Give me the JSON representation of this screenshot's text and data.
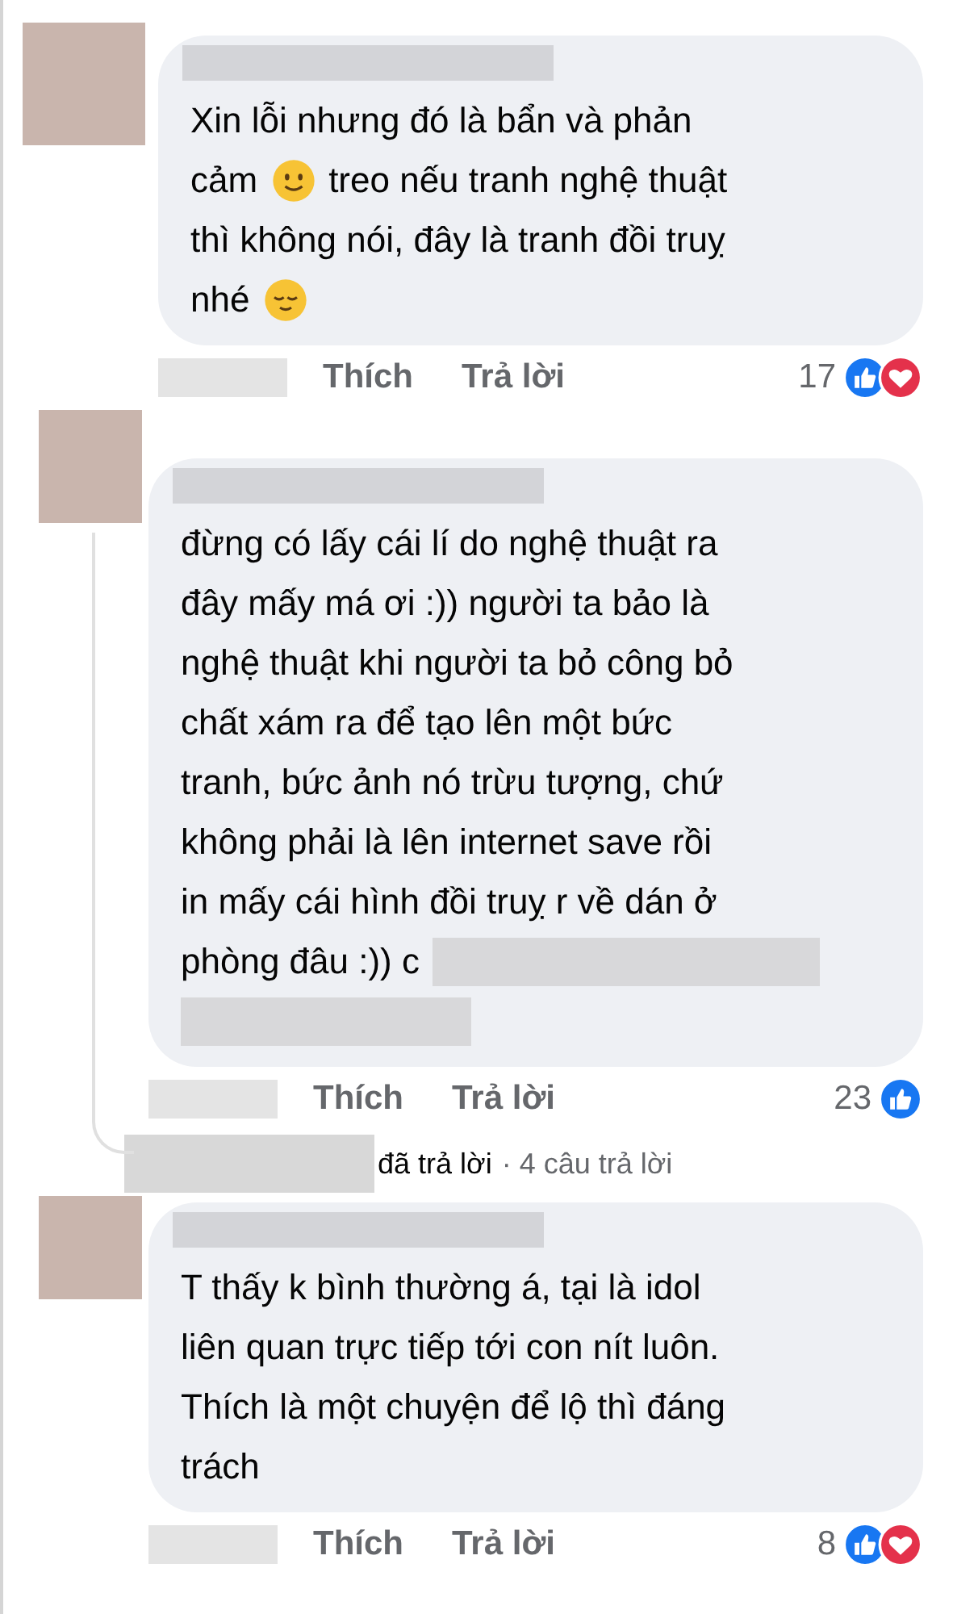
{
  "comments": [
    {
      "lines": [
        [
          {
            "kind": "text",
            "text": "Xin lỗi nhưng đó là bẩn và phản"
          }
        ],
        [
          {
            "kind": "text",
            "text": "cảm"
          },
          {
            "kind": "smile"
          },
          {
            "kind": "text",
            "text": "treo nếu tranh nghệ thuật"
          }
        ],
        [
          {
            "kind": "text",
            "text": "thì không nói, đây là tranh đồi truỵ"
          }
        ],
        [
          {
            "kind": "text",
            "text": "nhé"
          },
          {
            "kind": "relieved"
          }
        ]
      ],
      "actions": [
        "Thích",
        "Trả lời"
      ],
      "reaction_count": "17",
      "reactions": [
        {
          "kind": "like"
        },
        {
          "kind": "love"
        }
      ]
    },
    {
      "lines": [
        [
          {
            "kind": "text",
            "text": "đừng có lấy cái lí do nghệ thuật ra"
          }
        ],
        [
          {
            "kind": "text",
            "text": "đây mấy má ơi :)) người ta bảo là"
          }
        ],
        [
          {
            "kind": "text",
            "text": "nghệ thuật khi người ta bỏ công bỏ"
          }
        ],
        [
          {
            "kind": "text",
            "text": "chất xám ra để tạo lên một bức"
          }
        ],
        [
          {
            "kind": "text",
            "text": "tranh, bức ảnh nó trừu tượng, chứ"
          }
        ],
        [
          {
            "kind": "text",
            "text": "không phải là lên internet save rồi"
          }
        ],
        [
          {
            "kind": "text",
            "text": "in mấy cái hình đồi truỵ r về dán ở"
          }
        ],
        [
          {
            "kind": "text",
            "text": "phòng đâu :)) c"
          },
          {
            "kind": "redaction"
          }
        ],
        [
          {
            "kind": "redaction"
          }
        ]
      ],
      "actions": [
        "Thích",
        "Trả lời"
      ],
      "reaction_count": "23",
      "reactions": [
        {
          "kind": "like"
        }
      ],
      "replies": {
        "text": "đã trả lời",
        "count": "· 4 câu trả lời"
      }
    },
    {
      "lines": [
        [
          {
            "kind": "text",
            "text": "T thấy k bình thường á, tại là idol"
          }
        ],
        [
          {
            "kind": "text",
            "text": "liên quan trực tiếp tới con nít luôn."
          }
        ],
        [
          {
            "kind": "text",
            "text": "Thích là một chuyện để lộ thì đáng"
          }
        ],
        [
          {
            "kind": "text",
            "text": "trách"
          }
        ]
      ],
      "actions": [
        "Thích",
        "Trả lời"
      ],
      "reaction_count": "8",
      "reactions": [
        {
          "kind": "like"
        },
        {
          "kind": "love"
        }
      ]
    }
  ]
}
